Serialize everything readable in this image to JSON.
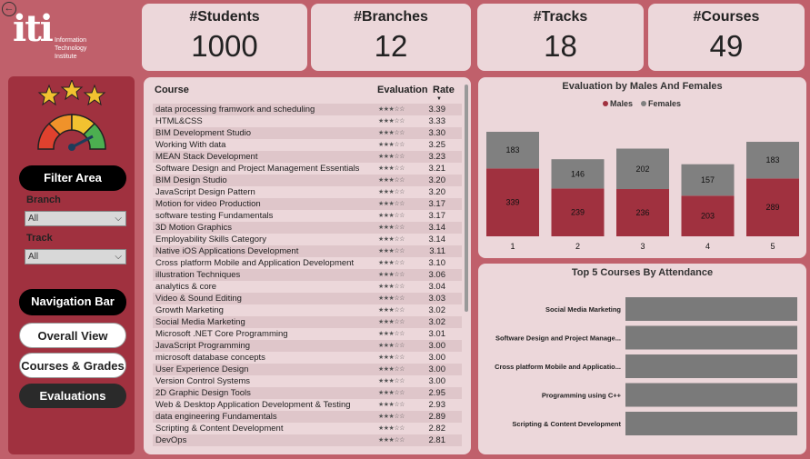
{
  "kpis": [
    {
      "title": "#Students",
      "value": "1000"
    },
    {
      "title": "#Branches",
      "value": "12"
    },
    {
      "title": "#Tracks",
      "value": "18"
    },
    {
      "title": "#Courses",
      "value": "49"
    }
  ],
  "logo": {
    "line1": "Information",
    "line2": "Technology",
    "line3": "Institute"
  },
  "sidebar": {
    "filter_label": "Filter Area",
    "branch_label": "Branch",
    "branch_value": "All",
    "track_label": "Track",
    "track_value": "All",
    "nav_label": "Navigation Bar",
    "nav_items": [
      "Overall View",
      "Courses & Grades",
      "Evaluations"
    ]
  },
  "table": {
    "headers": {
      "course": "Course",
      "evaluation": "Evaluation",
      "rate": "Rate"
    },
    "rows": [
      {
        "course": "data processing framwork and scheduling",
        "rate": "3.39"
      },
      {
        "course": "HTML&CSS",
        "rate": "3.33"
      },
      {
        "course": "BIM Development Studio",
        "rate": "3.30"
      },
      {
        "course": "Working With data",
        "rate": "3.25"
      },
      {
        "course": "MEAN Stack Development",
        "rate": "3.23"
      },
      {
        "course": "Software Design and Project Management Essentials",
        "rate": "3.21"
      },
      {
        "course": "BIM Design Studio",
        "rate": "3.20"
      },
      {
        "course": "JavaScript Design Pattern",
        "rate": "3.20"
      },
      {
        "course": "Motion for video Production",
        "rate": "3.17"
      },
      {
        "course": "software testing Fundamentals",
        "rate": "3.17"
      },
      {
        "course": "3D Motion Graphics",
        "rate": "3.14"
      },
      {
        "course": "Employability Skills Category",
        "rate": "3.14"
      },
      {
        "course": "Native iOS Applications Development",
        "rate": "3.11"
      },
      {
        "course": "Cross platform Mobile and Application Development",
        "rate": "3.10"
      },
      {
        "course": "illustration Techniques",
        "rate": "3.06"
      },
      {
        "course": "analytics & core",
        "rate": "3.04"
      },
      {
        "course": "Video & Sound Editing",
        "rate": "3.03"
      },
      {
        "course": "Growth Marketing",
        "rate": "3.02"
      },
      {
        "course": "Social Media Marketing",
        "rate": "3.02"
      },
      {
        "course": "Microsoft .NET Core Programming",
        "rate": "3.01"
      },
      {
        "course": "JavaScript Programming",
        "rate": "3.00"
      },
      {
        "course": "microsoft database concepts",
        "rate": "3.00"
      },
      {
        "course": "User Experience Design",
        "rate": "3.00"
      },
      {
        "course": "Version Control Systems",
        "rate": "3.00"
      },
      {
        "course": "2D Graphic Design Tools",
        "rate": "2.95"
      },
      {
        "course": "Web & Desktop Application Development & Testing",
        "rate": "2.93"
      },
      {
        "course": "data engineering Fundamentals",
        "rate": "2.89"
      },
      {
        "course": "Scripting & Content Development",
        "rate": "2.82"
      },
      {
        "course": "DevOps",
        "rate": "2.81"
      }
    ],
    "stars_glyph": "★★★☆☆"
  },
  "colors": {
    "male": "#a0313f",
    "female": "#808080",
    "bar_gray": "#7a7a7a",
    "bg": "#c0606b"
  },
  "chart_data": [
    {
      "type": "bar",
      "stacked": true,
      "title": "Evaluation by Males And Females",
      "categories": [
        "1",
        "2",
        "3",
        "4",
        "5"
      ],
      "series": [
        {
          "name": "Males",
          "values": [
            339,
            239,
            236,
            203,
            289
          ]
        },
        {
          "name": "Females",
          "values": [
            183,
            146,
            202,
            157,
            183
          ]
        }
      ],
      "legend": "top-center"
    },
    {
      "type": "bar",
      "orientation": "horizontal",
      "title": "Top 5 Courses By Attendance",
      "categories": [
        "Social Media Marketing",
        "Software Design and Project Manage...",
        "Cross platform Mobile and Applicatio...",
        "Programming using C++",
        "Scripting & Content Development"
      ],
      "values": [
        100,
        100,
        100,
        100,
        100
      ]
    }
  ]
}
